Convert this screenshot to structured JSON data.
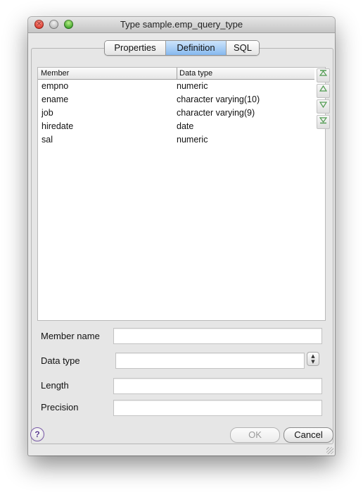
{
  "window": {
    "title": "Type sample.emp_query_type",
    "close_glyph": "×"
  },
  "tabs": [
    {
      "label": "Properties",
      "active": false
    },
    {
      "label": "Definition",
      "active": true
    },
    {
      "label": "SQL",
      "active": false
    }
  ],
  "members_table": {
    "columns": [
      "Member",
      "Data type"
    ],
    "rows": [
      {
        "member": "empno",
        "data_type": "numeric"
      },
      {
        "member": "ename",
        "data_type": "character varying(10)"
      },
      {
        "member": "job",
        "data_type": "character varying(9)"
      },
      {
        "member": "hiredate",
        "data_type": "date"
      },
      {
        "member": "sal",
        "data_type": "numeric"
      }
    ]
  },
  "move_buttons": {
    "top_icon": "move-top-icon",
    "up_icon": "move-up-icon",
    "down_icon": "move-down-icon",
    "bottom_icon": "move-bottom-icon"
  },
  "form": {
    "member_name_label": "Member name",
    "member_name_value": "",
    "data_type_label": "Data type",
    "data_type_value": "",
    "length_label": "Length",
    "length_value": "",
    "precision_label": "Precision",
    "precision_value": ""
  },
  "footer": {
    "help_glyph": "?",
    "ok_label": "OK",
    "cancel_label": "Cancel"
  }
}
